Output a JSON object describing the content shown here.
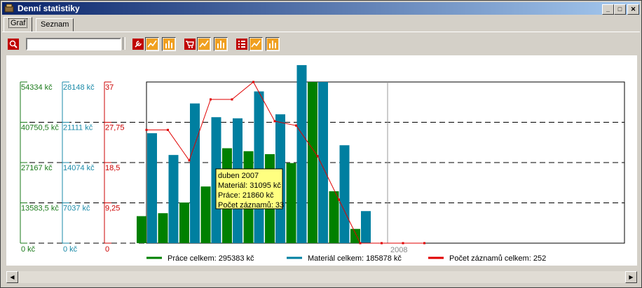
{
  "window": {
    "title": "Denní statistiky"
  },
  "tabs": [
    {
      "label": "Graf"
    },
    {
      "label": "Seznam"
    }
  ],
  "chart_data": {
    "type": "bar",
    "axes": [
      {
        "name": "Práce",
        "color": "#1a7a1a",
        "ticks": [
          "0 kč",
          "13583,5 kč",
          "27167 kč",
          "40750,5 kč",
          "54334 kč"
        ],
        "max": 54334
      },
      {
        "name": "Materiál",
        "color": "#1a8aa8",
        "ticks": [
          "0 kč",
          "7037 kč",
          "14074 kč",
          "21111 kč",
          "28148 kč"
        ],
        "max": 28148
      },
      {
        "name": "Počet záznamů",
        "color": "#cc0000",
        "ticks": [
          "0",
          "9,25",
          "18,5",
          "27,75",
          "37"
        ],
        "max": 37
      }
    ],
    "x_label": "2008",
    "series": [
      {
        "name": "Práce celkem: 295383 kč",
        "type": "bar",
        "color": "#008000",
        "values": [
          9100,
          10100,
          13700,
          19100,
          32000,
          31000,
          30000,
          27000,
          54334,
          17500,
          4800,
          0,
          0,
          0
        ]
      },
      {
        "name": "Materiál celkem: 185878 kč",
        "type": "bar",
        "color": "#007fa0",
        "values": [
          19200,
          15400,
          24400,
          22000,
          21800,
          26500,
          22500,
          31095,
          28148,
          17100,
          5600,
          0,
          0,
          0
        ]
      },
      {
        "name": "Počet záznamů celkem: 252",
        "type": "line",
        "color": "#e00000",
        "values": [
          26,
          26,
          19,
          33,
          33,
          37,
          28,
          27,
          20,
          10,
          0,
          0,
          0,
          0
        ]
      }
    ],
    "tooltip": {
      "lines": [
        "duben 2007",
        "Materiál: 31095 kč",
        "Práce: 21860 kč",
        "Počet záznamů: 33"
      ]
    }
  }
}
